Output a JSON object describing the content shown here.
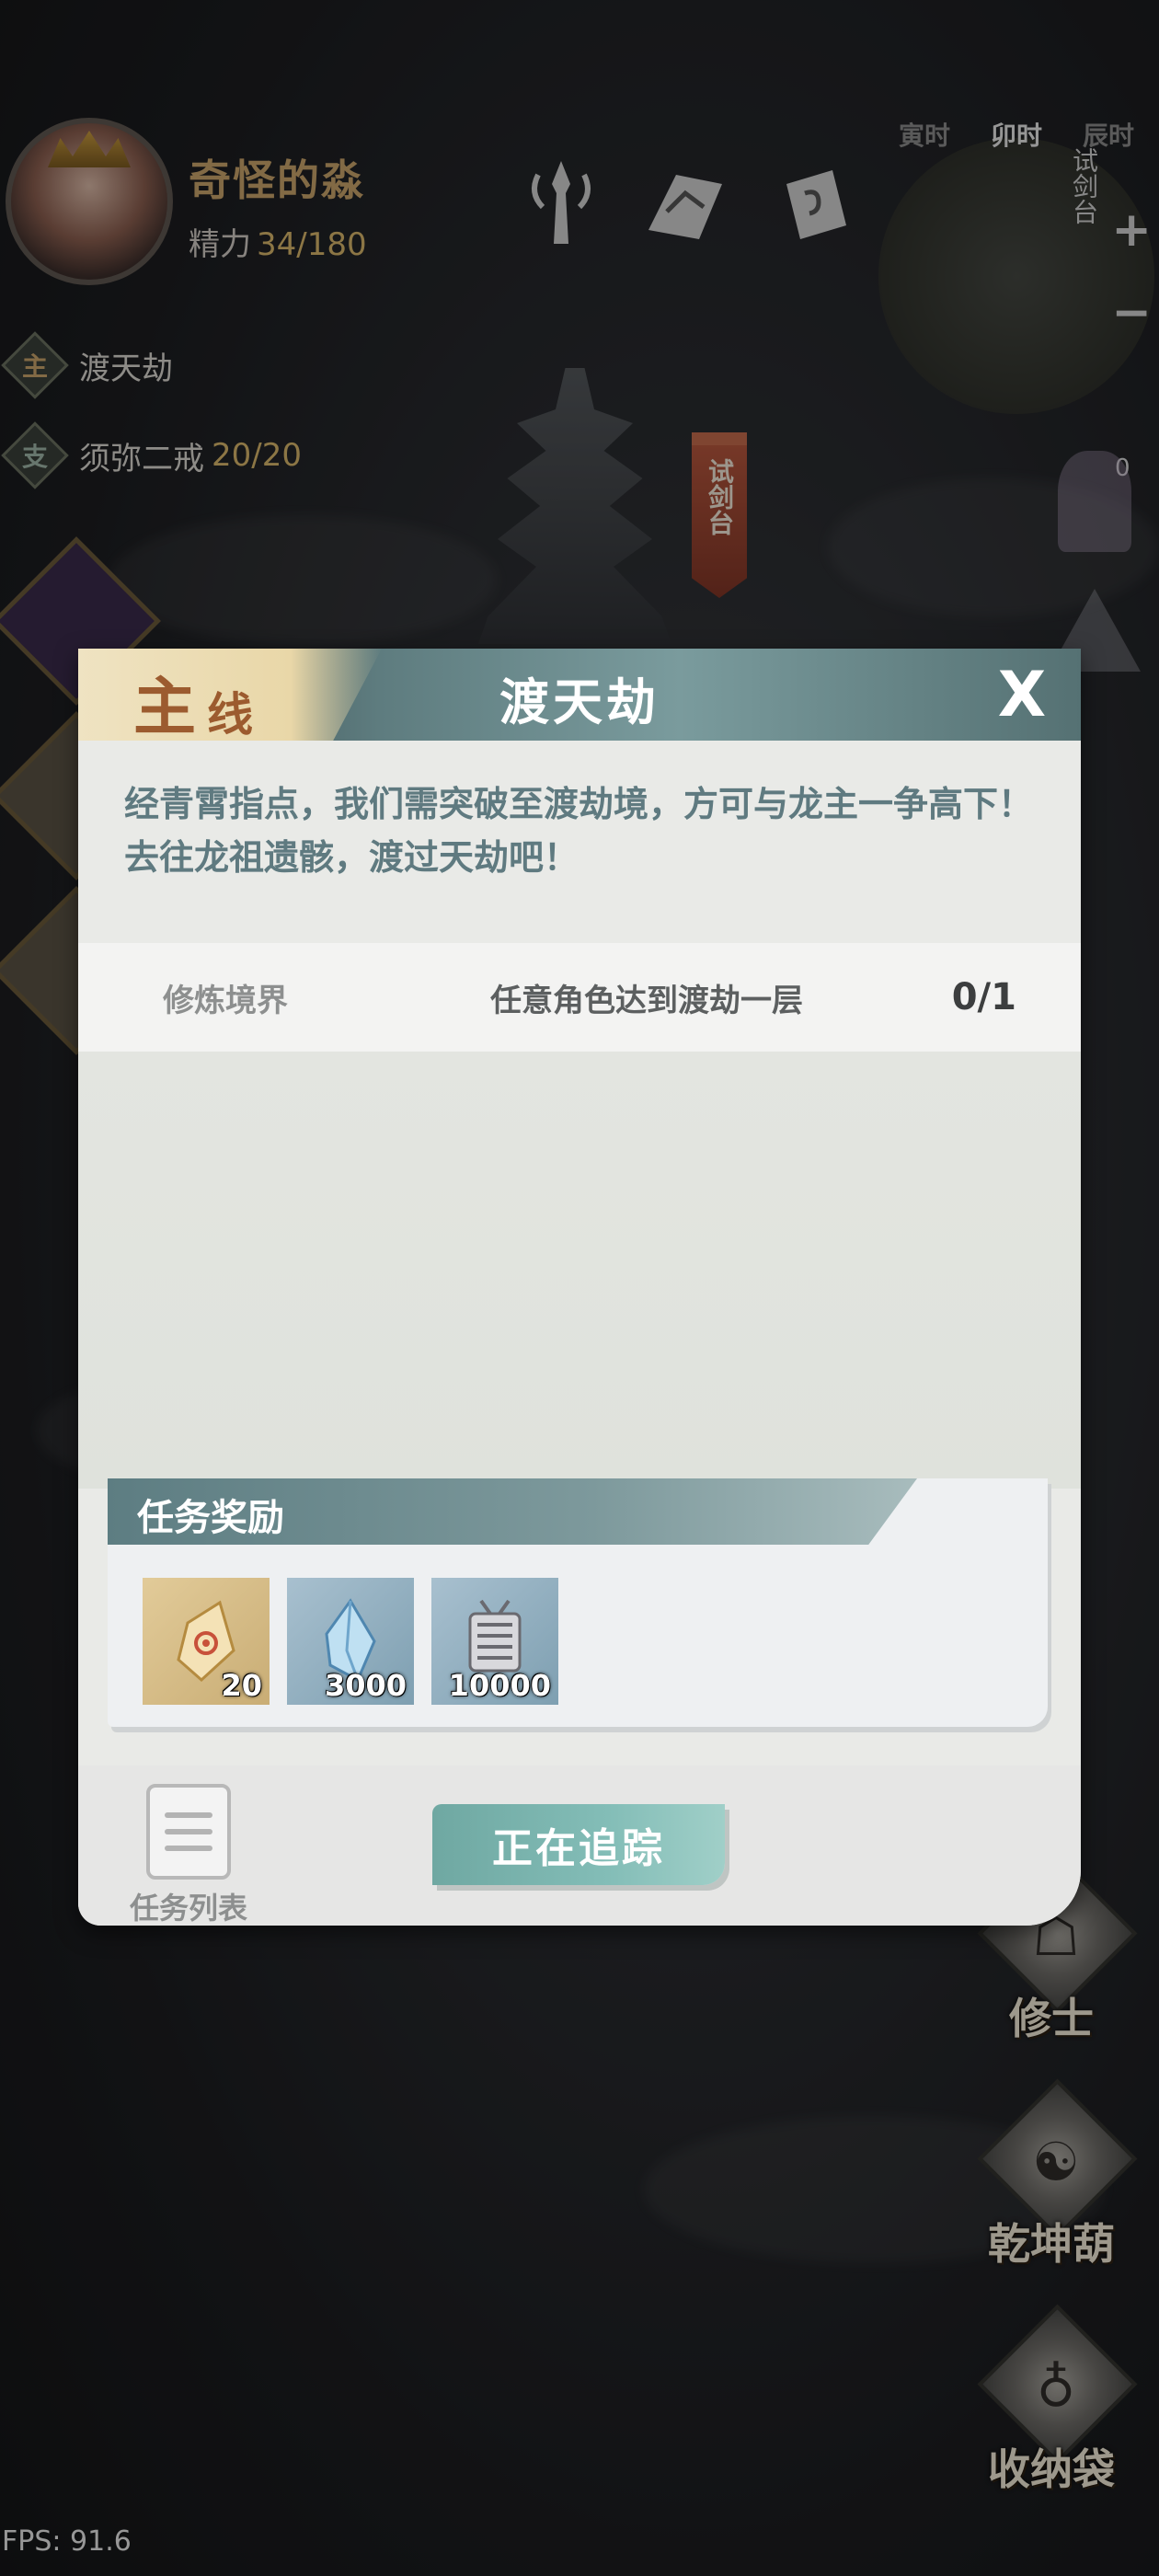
{
  "hud": {
    "player_name": "奇怪的淼",
    "stamina_label": "精力",
    "stamina_value": "34/180",
    "quests": [
      {
        "tag": "主",
        "name": "渡天劫",
        "count": ""
      },
      {
        "tag": "支",
        "name": "须弥二戒",
        "count": "20/20"
      }
    ],
    "time_slots": [
      "寅时",
      "卯时",
      "辰时"
    ],
    "active_time": "卯时",
    "map_zoom_in": "+",
    "map_zoom_out": "−",
    "map_location_label": "试剑台",
    "tower_flag": "试剑台",
    "counter": "0",
    "fps": "FPS: 91.6"
  },
  "side_buttons": [
    {
      "label": "修士",
      "icon": "cultivator-icon"
    },
    {
      "label": "乾坤葫",
      "icon": "gourd-icon"
    },
    {
      "label": "收纳袋",
      "icon": "bag-icon"
    }
  ],
  "dialog": {
    "tag_main": "主",
    "tag_sub": "线",
    "title": "渡天劫",
    "close_glyph": "X",
    "description": "经青霄指点，我们需突破至渡劫境，方可与龙主一争高下！去往龙祖遗骸，渡过天劫吧！",
    "objective": {
      "category": "修炼境界",
      "text": "任意角色达到渡劫一层",
      "progress": "0/1"
    },
    "rewards_title": "任务奖励",
    "rewards": [
      {
        "item": "crystal-shard",
        "qty": "20"
      },
      {
        "item": "blue-crystal",
        "qty": "3000"
      },
      {
        "item": "scroll-bundle",
        "qty": "10000"
      }
    ],
    "task_list_label": "任务列表",
    "track_button": "正在追踪"
  },
  "colors": {
    "accent_teal": "#6fa8a2",
    "tag_brown": "#9c5b2f",
    "gold_text": "#d7b56a"
  }
}
